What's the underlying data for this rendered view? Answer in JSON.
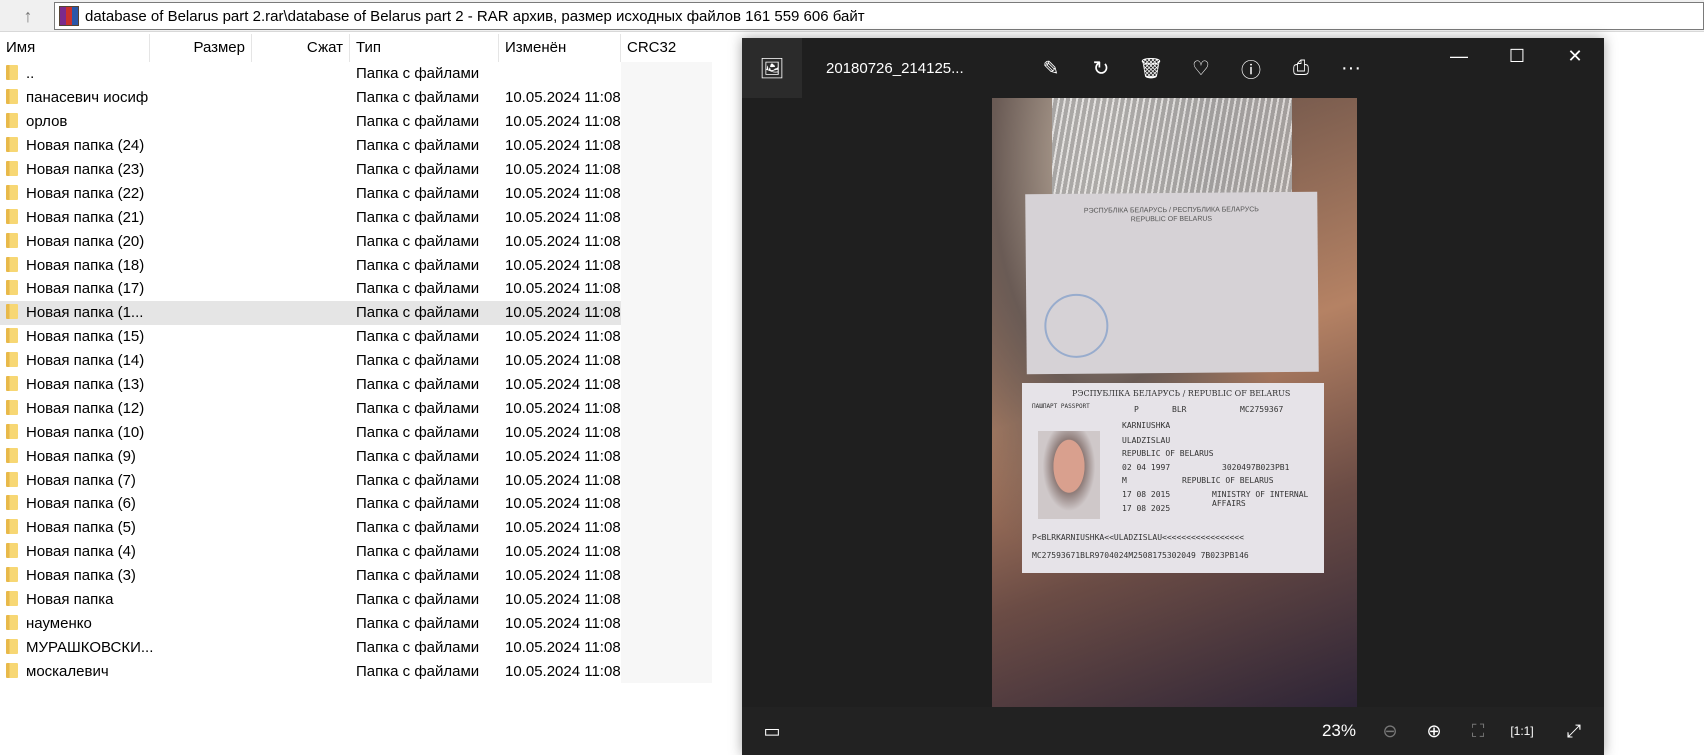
{
  "address": {
    "path": "database of Belarus part 2.rar\\database of Belarus part 2 - RAR архив, размер исходных файлов 161 559 606 байт"
  },
  "columns": [
    "Имя",
    "Размер",
    "Сжат",
    "Тип",
    "Изменён",
    "CRC32"
  ],
  "rows": [
    {
      "name": "..",
      "type": "Папка с файлами",
      "modified": ""
    },
    {
      "name": "панасевич иосиф",
      "type": "Папка с файлами",
      "modified": "10.05.2024 11:08"
    },
    {
      "name": "орлов",
      "type": "Папка с файлами",
      "modified": "10.05.2024 11:08"
    },
    {
      "name": "Новая папка (24)",
      "type": "Папка с файлами",
      "modified": "10.05.2024 11:08"
    },
    {
      "name": "Новая папка (23)",
      "type": "Папка с файлами",
      "modified": "10.05.2024 11:08"
    },
    {
      "name": "Новая папка (22)",
      "type": "Папка с файлами",
      "modified": "10.05.2024 11:08"
    },
    {
      "name": "Новая папка (21)",
      "type": "Папка с файлами",
      "modified": "10.05.2024 11:08"
    },
    {
      "name": "Новая папка (20)",
      "type": "Папка с файлами",
      "modified": "10.05.2024 11:08"
    },
    {
      "name": "Новая папка (18)",
      "type": "Папка с файлами",
      "modified": "10.05.2024 11:08"
    },
    {
      "name": "Новая папка (17)",
      "type": "Папка с файлами",
      "modified": "10.05.2024 11:08"
    },
    {
      "name": "Новая папка (1...",
      "type": "Папка с файлами",
      "modified": "10.05.2024 11:08",
      "selected": true
    },
    {
      "name": "Новая папка (15)",
      "type": "Папка с файлами",
      "modified": "10.05.2024 11:08"
    },
    {
      "name": "Новая папка (14)",
      "type": "Папка с файлами",
      "modified": "10.05.2024 11:08"
    },
    {
      "name": "Новая папка (13)",
      "type": "Папка с файлами",
      "modified": "10.05.2024 11:08"
    },
    {
      "name": "Новая папка (12)",
      "type": "Папка с файлами",
      "modified": "10.05.2024 11:08"
    },
    {
      "name": "Новая папка (10)",
      "type": "Папка с файлами",
      "modified": "10.05.2024 11:08"
    },
    {
      "name": "Новая папка (9)",
      "type": "Папка с файлами",
      "modified": "10.05.2024 11:08"
    },
    {
      "name": "Новая папка (7)",
      "type": "Папка с файлами",
      "modified": "10.05.2024 11:08"
    },
    {
      "name": "Новая папка (6)",
      "type": "Папка с файлами",
      "modified": "10.05.2024 11:08"
    },
    {
      "name": "Новая папка (5)",
      "type": "Папка с файлами",
      "modified": "10.05.2024 11:08"
    },
    {
      "name": "Новая папка (4)",
      "type": "Папка с файлами",
      "modified": "10.05.2024 11:08"
    },
    {
      "name": "Новая папка (3)",
      "type": "Папка с файлами",
      "modified": "10.05.2024 11:08"
    },
    {
      "name": "Новая папка",
      "type": "Папка с файлами",
      "modified": "10.05.2024 11:08"
    },
    {
      "name": "науменко",
      "type": "Папка с файлами",
      "modified": "10.05.2024 11:08"
    },
    {
      "name": "МУРАШКОВСКИ...",
      "type": "Папка с файлами",
      "modified": "10.05.2024 11:08"
    },
    {
      "name": "москалевич",
      "type": "Папка с файлами",
      "modified": "10.05.2024 11:08"
    }
  ],
  "viewer": {
    "filename": "20180726_214125...",
    "zoom": "23%",
    "photo": {
      "header": "РЭСПУБЛІКА БЕЛАРУСЬ / REPUBLIC OF BELARUS",
      "top_header": "РЭСПУБЛІКА БЕЛАРУСЬ / РЕСПУБЛИКА БЕЛАРУСЬ",
      "top_sub": "REPUBLIC OF BELARUS",
      "doc": "ПАШПАРТ PASSPORT",
      "type": "P",
      "code": "BLR",
      "number": "MC2759367",
      "surname": "KARNIUSHKA",
      "given": "ULADZISLAU",
      "nationality": "REPUBLIC OF BELARUS",
      "dob": "02 04 1997",
      "idno": "3020497B023PB1",
      "sex": "M",
      "pob": "REPUBLIC OF BELARUS",
      "issue": "17 08 2015",
      "authority": "MINISTRY OF INTERNAL AFFAIRS",
      "expiry": "17 08 2025",
      "mrz1": "P<BLRKARNIUSHKA<<ULADZISLAU<<<<<<<<<<<<<<<<<",
      "mrz2": "MC27593671BLR9704024M2508175302049 7B023PB146"
    }
  }
}
